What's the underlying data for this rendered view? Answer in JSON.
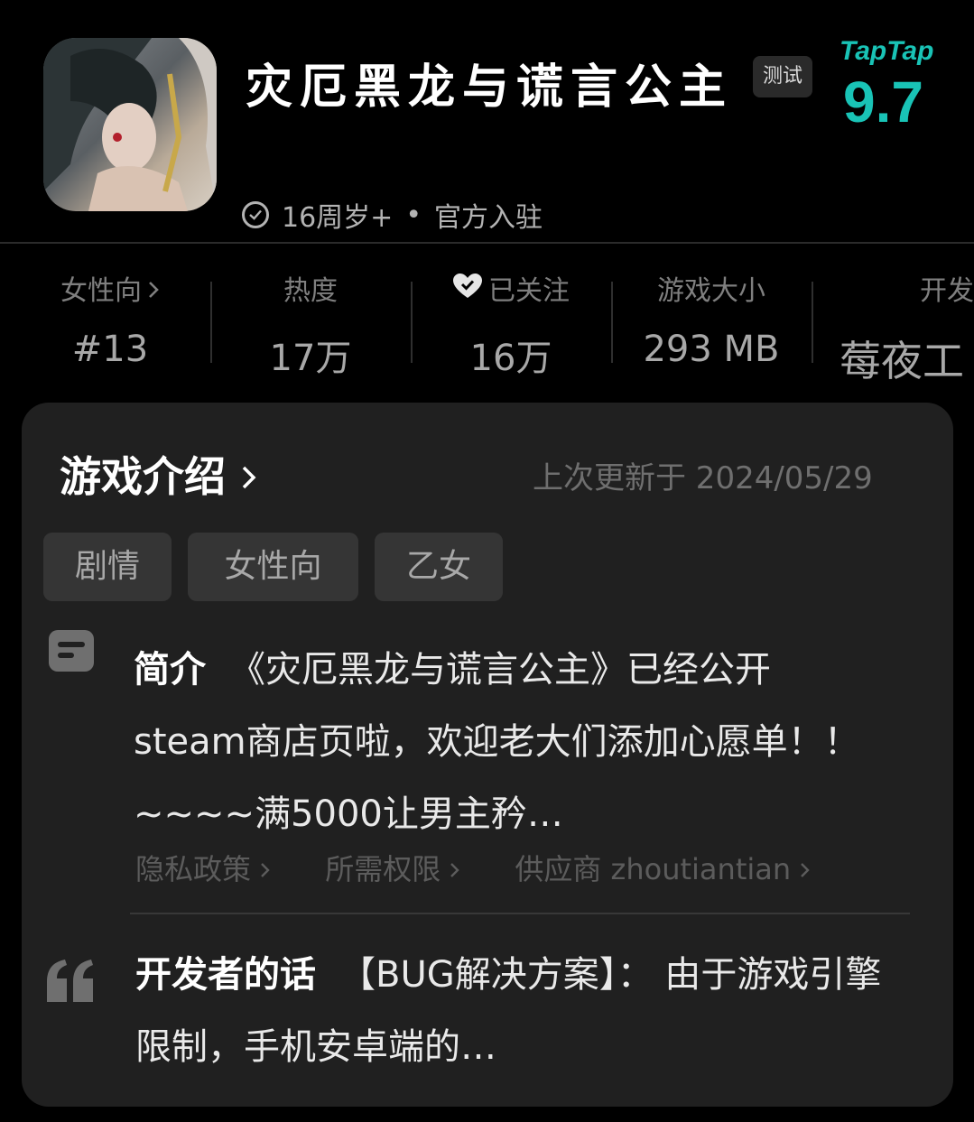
{
  "header": {
    "app_title": "灾厄黑龙与谎言公主",
    "test_badge": "测试",
    "store_logo": "TapTap",
    "score": "9.7",
    "age_rating": "16周岁+",
    "separator": "•",
    "official_label": "官方入驻",
    "icon": "check-circle-icon"
  },
  "stats": [
    {
      "label": "女性向",
      "value": "#13",
      "icon": "chevron-right-icon"
    },
    {
      "label": "热度",
      "value": "17万"
    },
    {
      "label": "已关注",
      "value": "16万",
      "icon": "heart-check-icon"
    },
    {
      "label": "游戏大小",
      "value": "293 MB"
    },
    {
      "label": "开发",
      "value": "莓夜工"
    }
  ],
  "intro": {
    "title": "游戏介绍",
    "updated": "上次更新于 2024/05/29",
    "tags": [
      "剧情",
      "女性向",
      "乙女"
    ],
    "summary_label": "简介",
    "summary_text": "《灾厄黑龙与谎言公主》已经公开steam商店页啦，欢迎老大们添加心愿单！！~~~~满5000让男主矜…",
    "links": [
      {
        "label": "隐私政策"
      },
      {
        "label": "所需权限"
      },
      {
        "label": "供应商 zhoutiantian"
      }
    ],
    "dev_label": "开发者的话",
    "dev_text": "【BUG解决方案】： 由于游戏引擎限制，手机安卓端的…"
  },
  "colors": {
    "background": "#000000",
    "card": "#202020",
    "accent": "#19c3b6",
    "tag_bg": "#353535"
  }
}
